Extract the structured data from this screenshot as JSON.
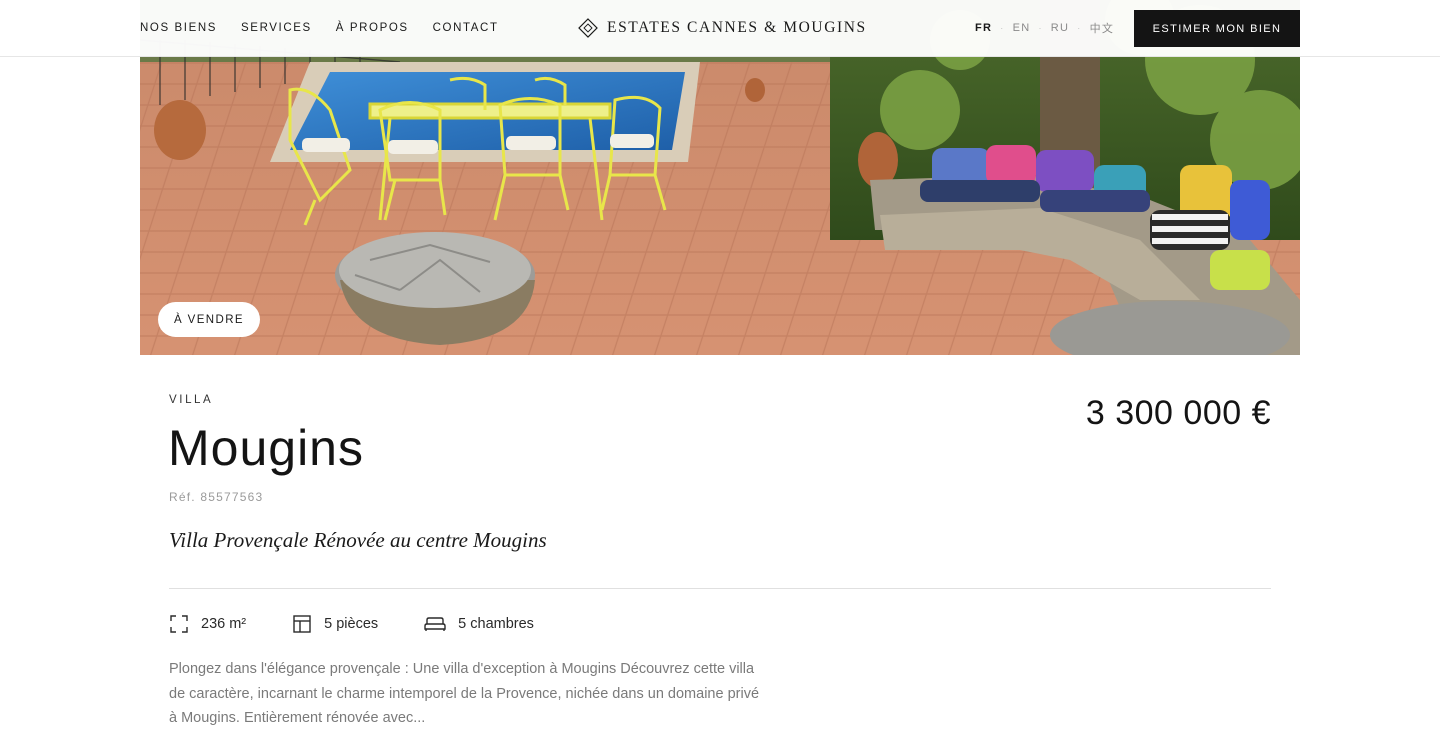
{
  "header": {
    "nav": [
      "NOS BIENS",
      "SERVICES",
      "À PROPOS",
      "CONTACT"
    ],
    "logo_text": "ESTATES CANNES & MOUGINS",
    "languages": [
      "FR",
      "EN",
      "RU",
      "中文"
    ],
    "active_language": "FR",
    "cta_label": "ESTIMER MON BIEN"
  },
  "listing": {
    "status_badge": "À VENDRE",
    "property_type": "VILLA",
    "title": "Mougins",
    "reference": "Réf. 85577563",
    "price": "3 300 000 €",
    "subtitle": "Villa Provençale Rénovée au centre Mougins",
    "features": {
      "surface": "236 m²",
      "rooms": "5 pièces",
      "bedrooms": "5 chambres"
    },
    "description": "Plongez dans l'élégance provençale : Une villa d'exception à Mougins Découvrez cette villa de caractère, incarnant le charme intemporel de la Provence, nichée dans un domaine privé à Mougins. Entièrement rénovée avec..."
  },
  "colors": {
    "cta_background": "#141414",
    "text_primary": "#141414",
    "text_muted": "#7a7a7a",
    "divider": "#e0e0e0"
  },
  "icons": {
    "logo": "diamond-logo-icon",
    "surface": "expand-corners-icon",
    "rooms": "floor-plan-icon",
    "bedrooms": "bed-icon"
  }
}
